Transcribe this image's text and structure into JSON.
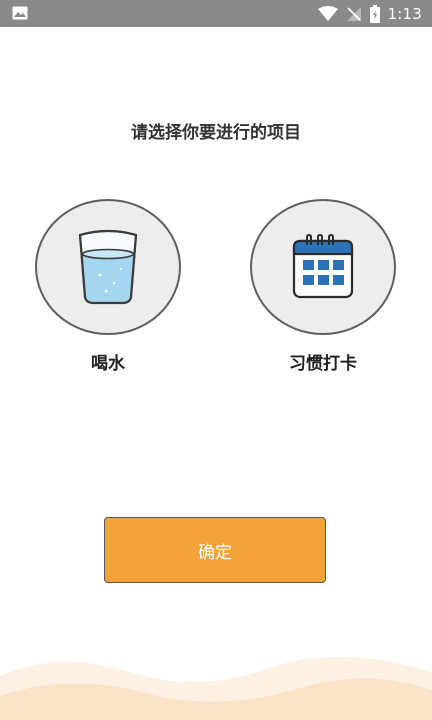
{
  "status_bar": {
    "time": "1:13",
    "icons": [
      "image-icon",
      "wifi-icon",
      "no-signal-icon",
      "battery-charging-icon"
    ]
  },
  "prompt": "请选择你要进行的项目",
  "options": [
    {
      "label": "喝水",
      "icon": "water-glass-icon"
    },
    {
      "label": "习惯打卡",
      "icon": "calendar-icon"
    }
  ],
  "confirm_label": "确定",
  "colors": {
    "status_bar": "#8a8a8a",
    "button": "#f3a23a",
    "circle_bg": "#ededed",
    "water": "#9fd3ee",
    "calendar_blue": "#2a73b8",
    "wave": "#fbe7d2"
  }
}
